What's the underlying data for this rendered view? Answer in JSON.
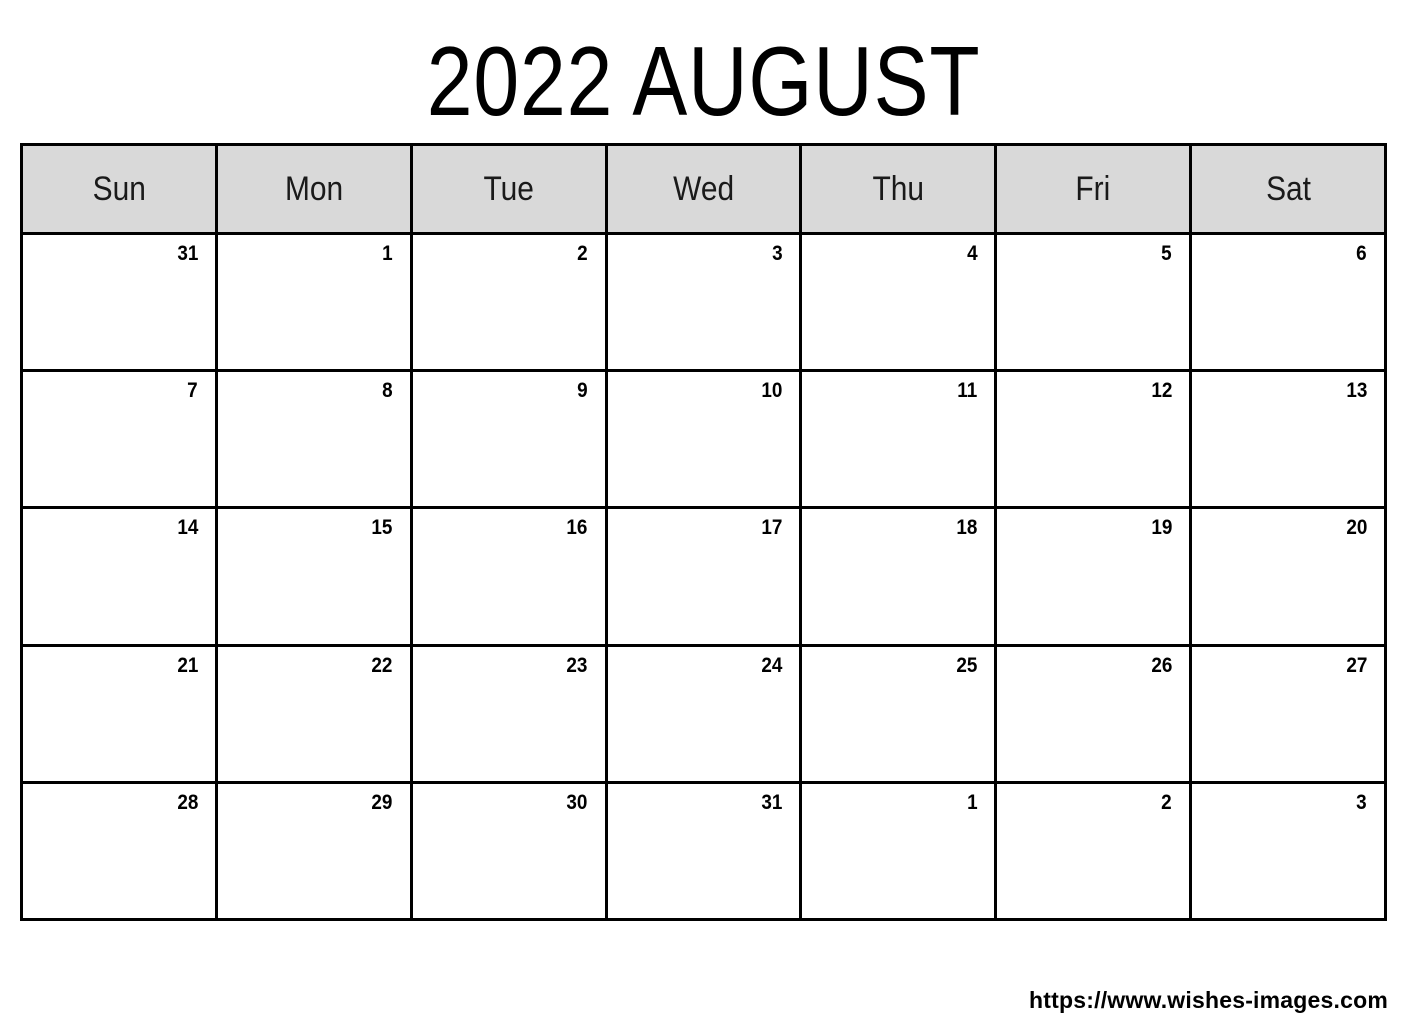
{
  "calendar": {
    "title": "2022 AUGUST",
    "year": "2022",
    "month": "AUGUST",
    "header_background": "#d9d9d9",
    "border_color": "#000000",
    "page_background": "#ffffff",
    "weekday_headers": [
      {
        "label": "Sun"
      },
      {
        "label": "Mon"
      },
      {
        "label": "Tue"
      },
      {
        "label": "Wed"
      },
      {
        "label": "Thu"
      },
      {
        "label": "Fri"
      },
      {
        "label": "Sat"
      }
    ],
    "weeks": [
      {
        "days": [
          {
            "number": "31"
          },
          {
            "number": "1"
          },
          {
            "number": "2"
          },
          {
            "number": "3"
          },
          {
            "number": "4"
          },
          {
            "number": "5"
          },
          {
            "number": "6"
          }
        ]
      },
      {
        "days": [
          {
            "number": "7"
          },
          {
            "number": "8"
          },
          {
            "number": "9"
          },
          {
            "number": "10"
          },
          {
            "number": "11"
          },
          {
            "number": "12"
          },
          {
            "number": "13"
          }
        ]
      },
      {
        "days": [
          {
            "number": "14"
          },
          {
            "number": "15"
          },
          {
            "number": "16"
          },
          {
            "number": "17"
          },
          {
            "number": "18"
          },
          {
            "number": "19"
          },
          {
            "number": "20"
          }
        ]
      },
      {
        "days": [
          {
            "number": "21"
          },
          {
            "number": "22"
          },
          {
            "number": "23"
          },
          {
            "number": "24"
          },
          {
            "number": "25"
          },
          {
            "number": "26"
          },
          {
            "number": "27"
          }
        ]
      },
      {
        "days": [
          {
            "number": "28"
          },
          {
            "number": "29"
          },
          {
            "number": "30"
          },
          {
            "number": "31"
          },
          {
            "number": "1"
          },
          {
            "number": "2"
          },
          {
            "number": "3"
          }
        ]
      }
    ]
  },
  "footer": {
    "url": "https://www.wishes-images.com"
  }
}
